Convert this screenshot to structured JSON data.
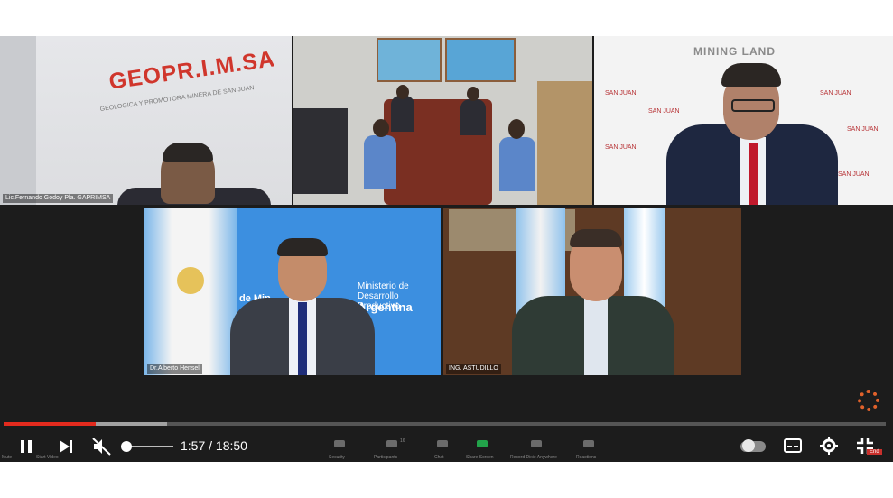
{
  "video": {
    "current_time": "1:57",
    "duration": "18:50",
    "time_display": "1:57 / 18:50",
    "played_fraction": 0.104,
    "buffered_fraction": 0.185,
    "volume_muted": true
  },
  "tiles": [
    {
      "name": "Lic.Fernando Godoy Pla. GAPRIMSA",
      "logo_text": "GEOPR.I.M.SA",
      "logo_sub": "GEOLOGICA Y PROMOTORA MINERA DE SAN JUAN"
    },
    {
      "name": ""
    },
    {
      "name": "",
      "banner": "MINING LAND",
      "mark": "SAN JUAN"
    },
    {
      "name": "Dr.Alberto Hensel",
      "wall_text_1": "de Min",
      "wall_text_2": "Ministerio de Desarrollo Productivo",
      "wall_text_3": "Argentina"
    },
    {
      "name": "ING. ASTUDILLO"
    }
  ],
  "zoom_toolbar": {
    "items": [
      "Mute",
      "Start Video",
      "Security",
      "Participants",
      "Chat",
      "Share Screen",
      "Record Dixie Anywhere",
      "Reactions"
    ],
    "participants_count": "16",
    "end_label": "End"
  },
  "colors": {
    "progress_played": "#e32b1e",
    "player_bg": "#1c1c1c",
    "accent_orange": "#e0612b"
  },
  "icons": {
    "pause": "pause-icon",
    "next": "next-icon",
    "mute": "volume-muted-icon",
    "autoplay": "autoplay-toggle",
    "subtitles": "subtitles-icon",
    "settings": "gear-icon",
    "exit_fullscreen": "exit-fullscreen-icon"
  }
}
